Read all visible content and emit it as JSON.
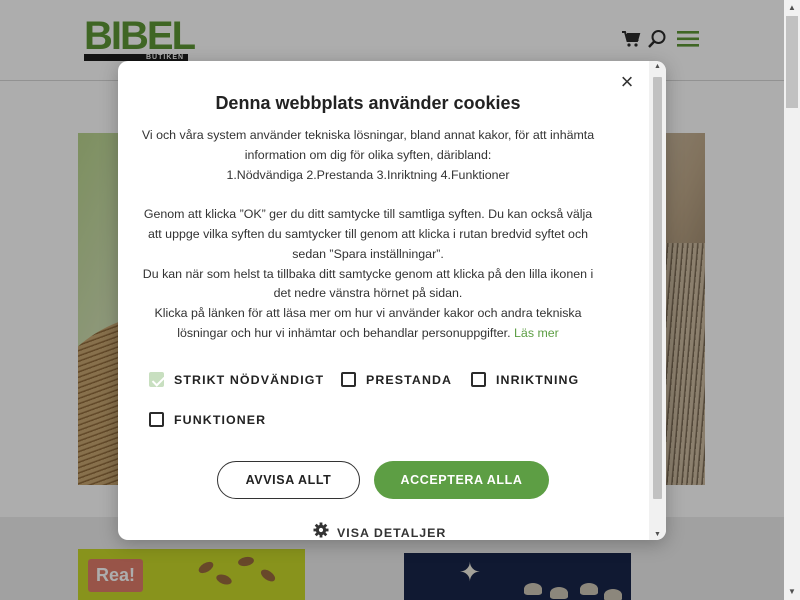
{
  "header": {
    "logo_text": "BIBEL",
    "logo_subtext": "BUTIKEN",
    "icons": [
      "cart-icon",
      "search-icon",
      "menu-icon"
    ]
  },
  "products": {
    "sale_badge": "Rea!"
  },
  "cookie_dialog": {
    "title": "Denna webbplats använder cookies",
    "close_label": "×",
    "intro_1": "Vi och våra system använder tekniska lösningar, bland annat kakor, för att inhämta information om dig för olika syften, däribland:",
    "intro_2": "1.Nödvändiga 2.Prestanda 3.Inriktning 4.Funktioner",
    "consent_text": "Genom att klicka ”OK” ger du ditt samtycke till samtliga syften. Du kan också välja att uppge vilka syften du samtycker till genom att klicka i rutan bredvid syftet och sedan ”Spara inställningar”.",
    "withdraw_text": "Du kan när som helst ta tillbaka ditt samtycke genom att klicka på den lilla ikonen i det nedre vänstra hörnet på sidan.",
    "link_intro": "Klicka på länken för att läsa mer om hur vi använder kakor och andra tekniska lösningar och hur vi inhämtar och behandlar personuppgifter.",
    "read_more": "Läs mer",
    "checkboxes": [
      {
        "label": "STRIKT NÖDVÄNDIGT",
        "checked": true,
        "disabled": true
      },
      {
        "label": "PRESTANDA",
        "checked": false
      },
      {
        "label": "INRIKTNING",
        "checked": false
      },
      {
        "label": "FUNKTIONER",
        "checked": false
      }
    ],
    "reject_label": "AVVISA ALLT",
    "accept_label": "ACCEPTERA ALLA",
    "details_label": "VISA DETALJER"
  },
  "colors": {
    "accent": "#5d9e44",
    "brand_green": "#5d9736",
    "overlay": "rgba(0,0,0,0.32)"
  }
}
